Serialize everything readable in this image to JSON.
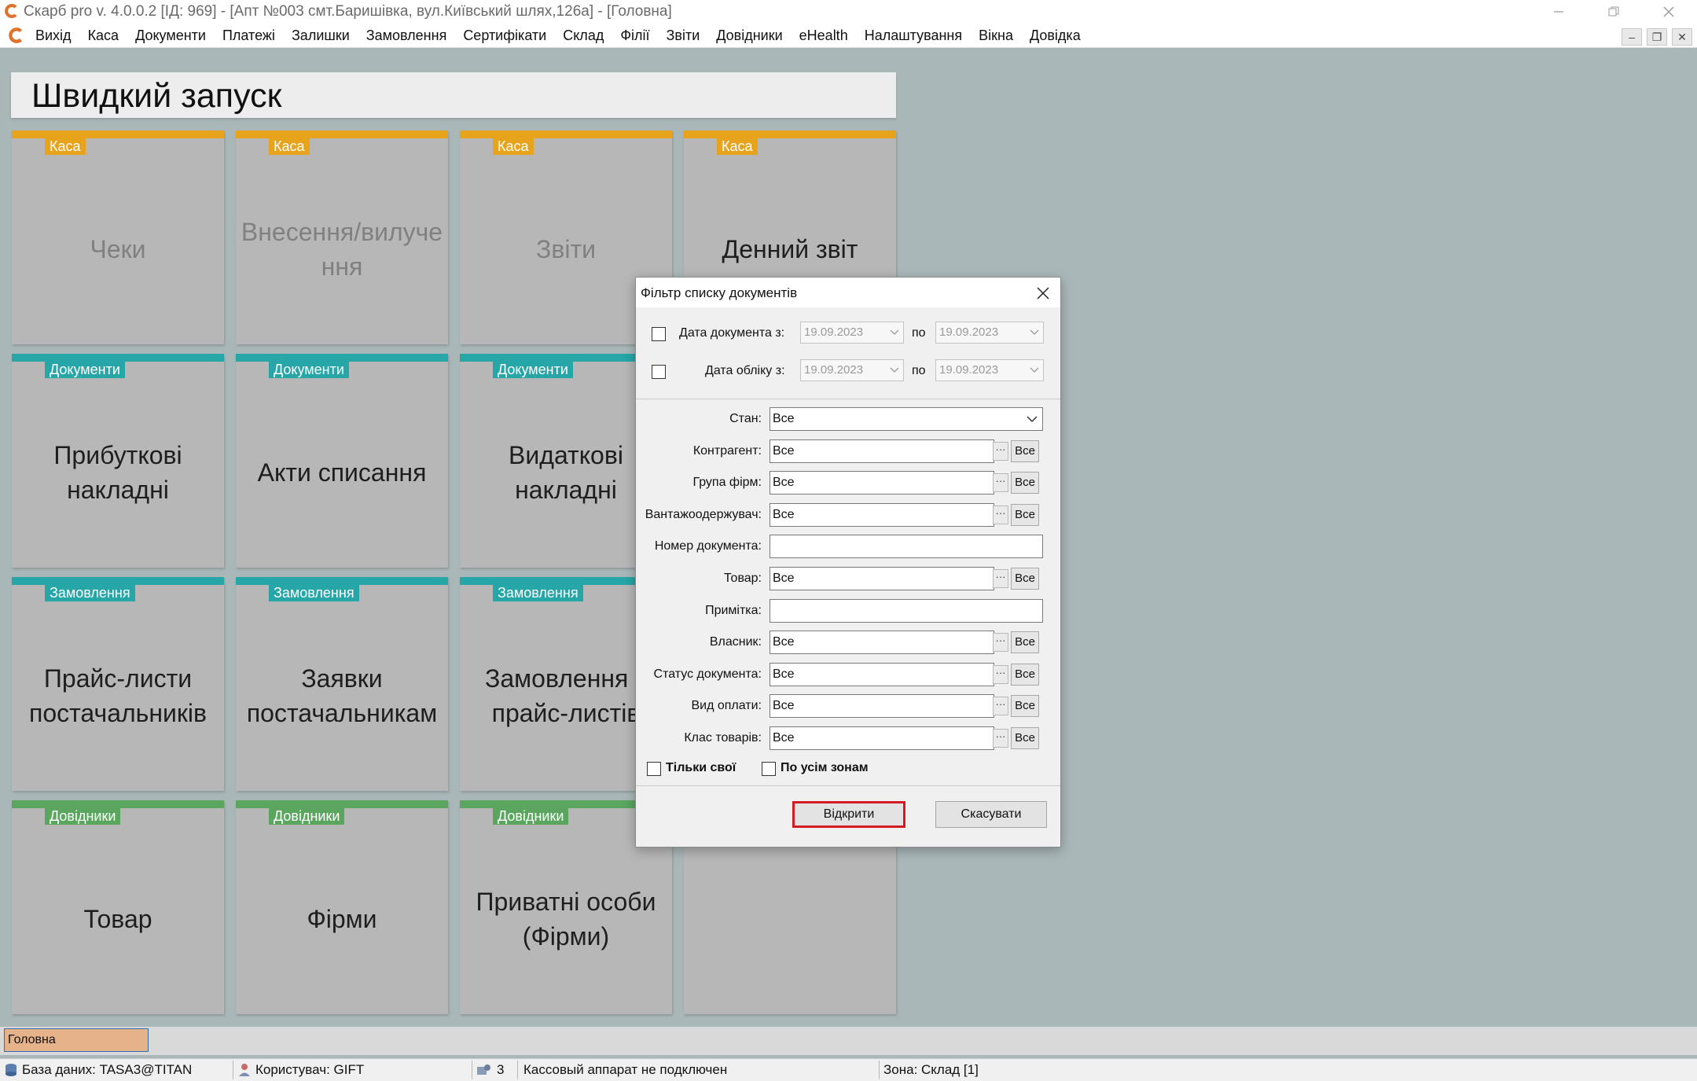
{
  "window": {
    "title": "Скарб pro v. 4.0.0.2 [ІД: 969] - [Апт №003 смт.Баришівка, вул.Київський шлях,126а] - [Головна]"
  },
  "menu": {
    "items": [
      "Вихід",
      "Каса",
      "Документи",
      "Платежі",
      "Залишки",
      "Замовлення",
      "Сертифікати",
      "Склад",
      "Філії",
      "Звіти",
      "Довідники",
      "eHealth",
      "Налаштування",
      "Вікна",
      "Довідка"
    ]
  },
  "quick_launch": {
    "title": "Швидкий запуск",
    "tiles": [
      {
        "category": "Каса",
        "label": "Чеки"
      },
      {
        "category": "Каса",
        "label": "Внесення/вилучення"
      },
      {
        "category": "Каса",
        "label": "Звіти"
      },
      {
        "category": "Каса",
        "label": "Денний звіт"
      },
      {
        "category": "Документи",
        "label": "Прибуткові накладні"
      },
      {
        "category": "Документи",
        "label": "Акти списання"
      },
      {
        "category": "Документи",
        "label": "Видаткові накладні"
      },
      {
        "category": "Замовлення",
        "label": "Прайс-листи постачальників"
      },
      {
        "category": "Замовлення",
        "label": "Заявки постачальникам"
      },
      {
        "category": "Замовлення",
        "label": "Замовлення з прайс-листів"
      },
      {
        "category": "Довідники",
        "label": "Товар"
      },
      {
        "category": "Довідники",
        "label": "Фірми"
      },
      {
        "category": "Довідники",
        "label": "Приватні особи (Фірми)"
      }
    ],
    "category_colors": {
      "Каса": "#e8a31c",
      "Документи": "#27a6a8",
      "Замовлення": "#27a6a8",
      "Довідники": "#5aa65f"
    }
  },
  "dialog": {
    "title": "Фільтр списку документів",
    "doc_date": {
      "label": "Дата документа з:",
      "from": "19.09.2023",
      "to_label": "по",
      "to": "19.09.2023",
      "checked": false
    },
    "acc_date": {
      "label": "Дата обліку з:",
      "from": "19.09.2023",
      "to_label": "по",
      "to": "19.09.2023",
      "checked": false
    },
    "fields": [
      {
        "label": "Стан:",
        "value": "Все",
        "kind": "select"
      },
      {
        "label": "Контрагент:",
        "value": "Все",
        "kind": "lookup"
      },
      {
        "label": "Група фірм:",
        "value": "Все",
        "kind": "lookup"
      },
      {
        "label": "Вантажоодержувач:",
        "value": "Все",
        "kind": "lookup"
      },
      {
        "label": "Номер документа:",
        "value": "",
        "kind": "text"
      },
      {
        "label": "Товар:",
        "value": "Все",
        "kind": "lookup"
      },
      {
        "label": "Примітка:",
        "value": "",
        "kind": "text"
      },
      {
        "label": "Власник:",
        "value": "Все",
        "kind": "lookup"
      },
      {
        "label": "Статус документа:",
        "value": "Все",
        "kind": "lookup"
      },
      {
        "label": "Вид оплати:",
        "value": "Все",
        "kind": "lookup"
      },
      {
        "label": "Клас товарів:",
        "value": "Все",
        "kind": "lookup"
      }
    ],
    "dots_label": "···",
    "all_label": "Все",
    "only_mine": {
      "label": "Тільки свої",
      "checked": false
    },
    "all_zones": {
      "label": "По усім зонам",
      "checked": false
    },
    "open_button": "Відкрити",
    "cancel_button": "Скасувати"
  },
  "taskbar": {
    "active_tab": "Головна"
  },
  "status": {
    "database": "База даних: TASA3@TITAN",
    "user": "Користувач: GIFT",
    "count": "3",
    "cash_register": "Кассовый аппарат не подключен",
    "zone": "Зона: Склад [1]"
  }
}
